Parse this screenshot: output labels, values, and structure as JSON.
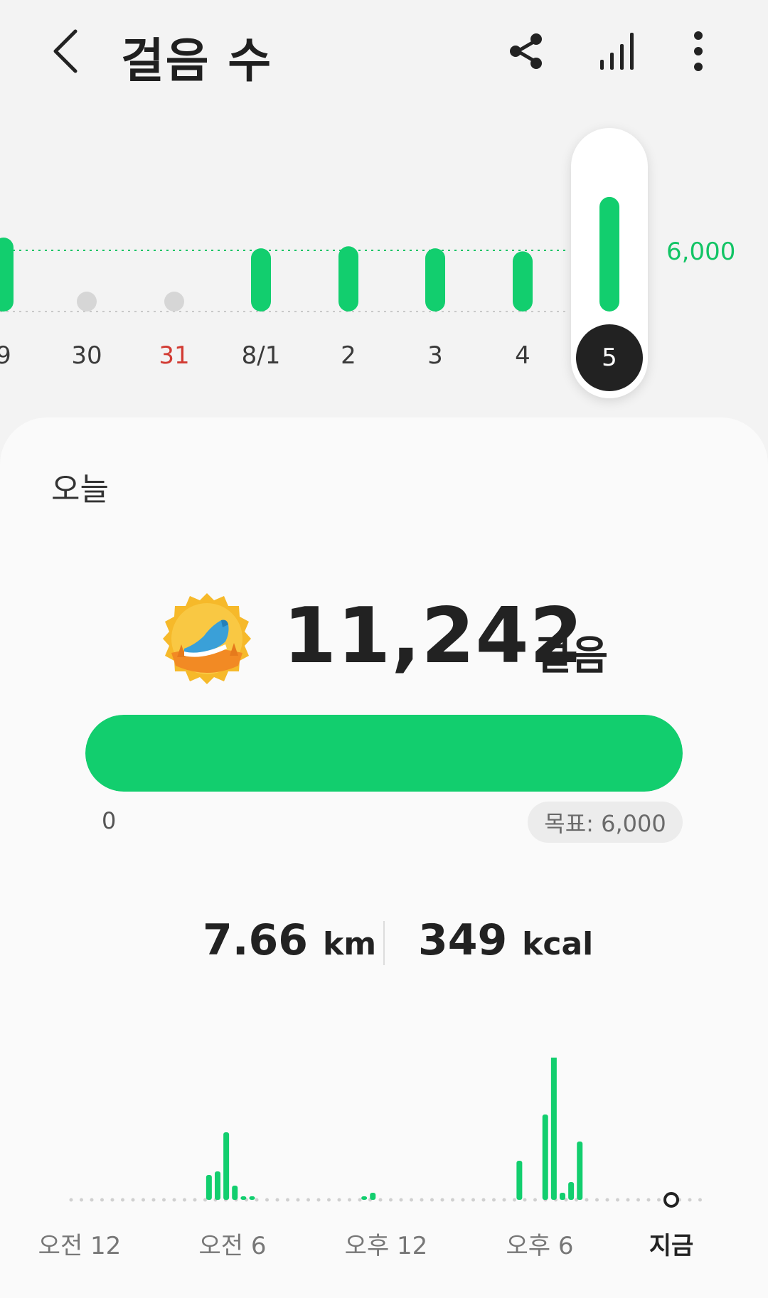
{
  "header": {
    "title": "걸음 수",
    "icons": [
      "back-arrow-icon",
      "share-icon",
      "bar-chart-icon",
      "more-vertical-icon"
    ]
  },
  "week_chart": {
    "goal_label": "6,000",
    "days": [
      {
        "label": "9",
        "has_data": true,
        "value": 7500,
        "red": false
      },
      {
        "label": "30",
        "has_data": false,
        "value": 0,
        "red": false
      },
      {
        "label": "31",
        "has_data": false,
        "value": 0,
        "red": true
      },
      {
        "label": "8/1",
        "has_data": true,
        "value": 6200,
        "red": false
      },
      {
        "label": "2",
        "has_data": true,
        "value": 6400,
        "red": false
      },
      {
        "label": "3",
        "has_data": true,
        "value": 6200,
        "red": false
      },
      {
        "label": "4",
        "has_data": true,
        "value": 5900,
        "red": false
      },
      {
        "label": "5",
        "has_data": true,
        "value": 11242,
        "red": false,
        "selected": true
      }
    ],
    "colors": {
      "bar": "#12ce6e",
      "goal_line": "#12c465",
      "empty_dot": "#d6d6d6"
    }
  },
  "today": {
    "label": "오늘",
    "steps": "11,242",
    "steps_unit": "걸음",
    "progress_fraction": 1.0,
    "progress_min": "0",
    "goal_chip": "목표: 6,000",
    "badge_icon": "running-shoe-medal-icon"
  },
  "stats": {
    "distance_value": "7.66",
    "distance_unit": "km",
    "calories_value": "349",
    "calories_unit": "kcal"
  },
  "hourly": {
    "labels": [
      "오전 12",
      "오전 6",
      "오후 12",
      "오후 6",
      "지금"
    ],
    "chart_data": {
      "type": "bar",
      "x": [
        "5:00",
        "5:20",
        "5:40",
        "6:00",
        "6:20",
        "6:40",
        "11:00",
        "11:20",
        "17:00",
        "18:00",
        "18:20",
        "18:40",
        "19:00",
        "19:20"
      ],
      "values": [
        35,
        40,
        95,
        20,
        5,
        5,
        5,
        10,
        55,
        120,
        210,
        10,
        25,
        82
      ],
      "xlabel": "",
      "ylabel": "",
      "color": "#12ce6e"
    }
  }
}
